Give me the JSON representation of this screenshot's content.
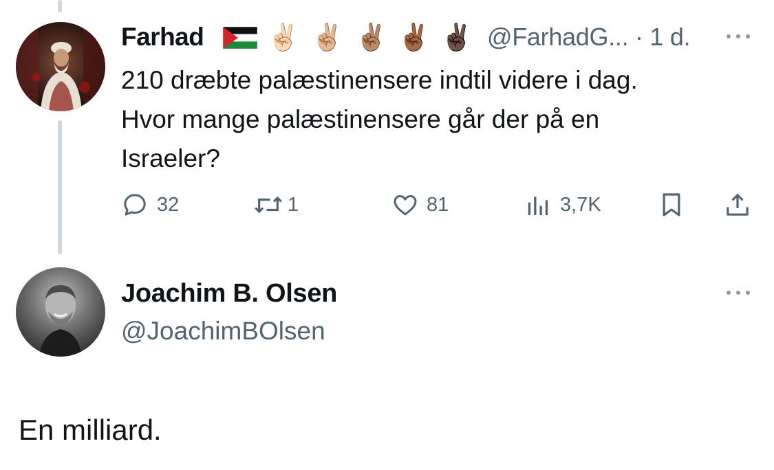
{
  "original_tweet": {
    "author_name": "Farhad",
    "flag_icon": "palestine-flag-icon",
    "emojis": [
      "✌🏻",
      "✌🏼",
      "✌🏽",
      "✌🏾",
      "✌🏿"
    ],
    "handle_time": "@FarhadG... · 1 d.",
    "text_lines": [
      "210 dræbte palæstinensere indtil videre i dag.",
      "Hvor mange palæstinensere går der på en",
      "Israeler?"
    ],
    "actions": {
      "replies": "32",
      "retweets": "1",
      "likes": "81",
      "views": "3,7K"
    }
  },
  "reply_tweet": {
    "author_name": "Joachim B. Olsen",
    "handle": "@JoachimBOlsen",
    "text": "En milliard."
  },
  "colors": {
    "text": "#0f1419",
    "secondary": "#536471",
    "thread_line": "#cfd9de",
    "background": "#ffffff"
  }
}
